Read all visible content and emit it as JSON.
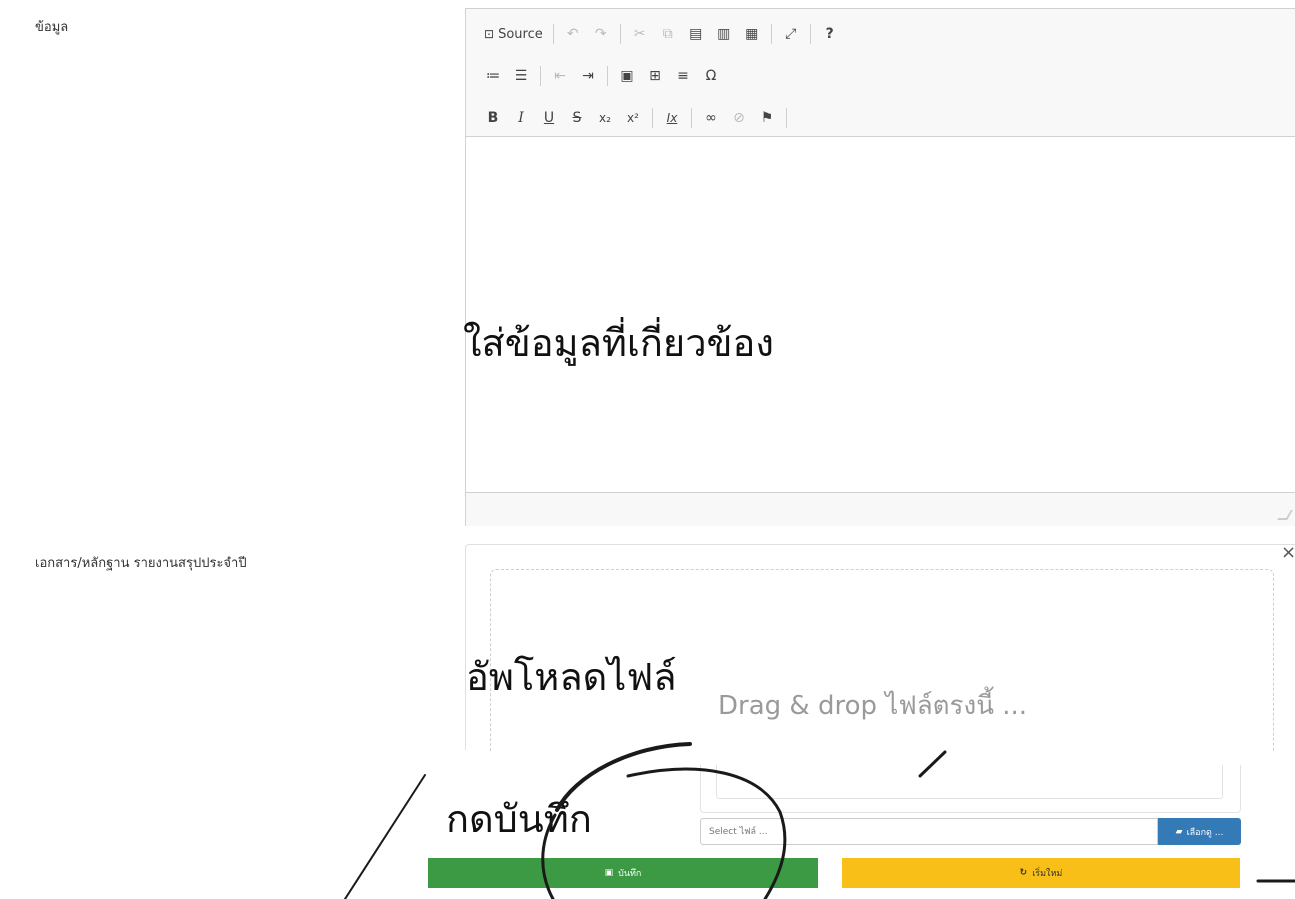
{
  "fields": {
    "content_label": "ข้อมูล",
    "document_label": "เอกสาร/หลักฐาน รายงานสรุปประจำปี"
  },
  "editor": {
    "toolbar": {
      "source_label": "Source",
      "help_label": "?",
      "special_char": "Ω",
      "bold": "B",
      "italic": "I",
      "underline": "U",
      "strike": "S",
      "subscript": "x₂",
      "superscript": "x²",
      "remove_format": "Ix"
    }
  },
  "upload": {
    "drop_hint": "Drag & drop ไฟล์ตรงนี้ ...",
    "close_glyph": "×",
    "file_placeholder": "Select ไฟล์ ...",
    "browse_label": "เลือกดู ..."
  },
  "actions": {
    "save_label": "บันทึก",
    "reset_label": "เริ่มใหม่"
  },
  "annotations": {
    "editor_hint": "ใส่ข้อมูลที่เกี่ยวข้อง",
    "upload_hint": "อัพโหลดไฟล์",
    "save_hint": "กดบันทึก"
  },
  "colors": {
    "save": "#3c9a45",
    "reset": "#f7bf17",
    "browse": "#337ab7"
  }
}
